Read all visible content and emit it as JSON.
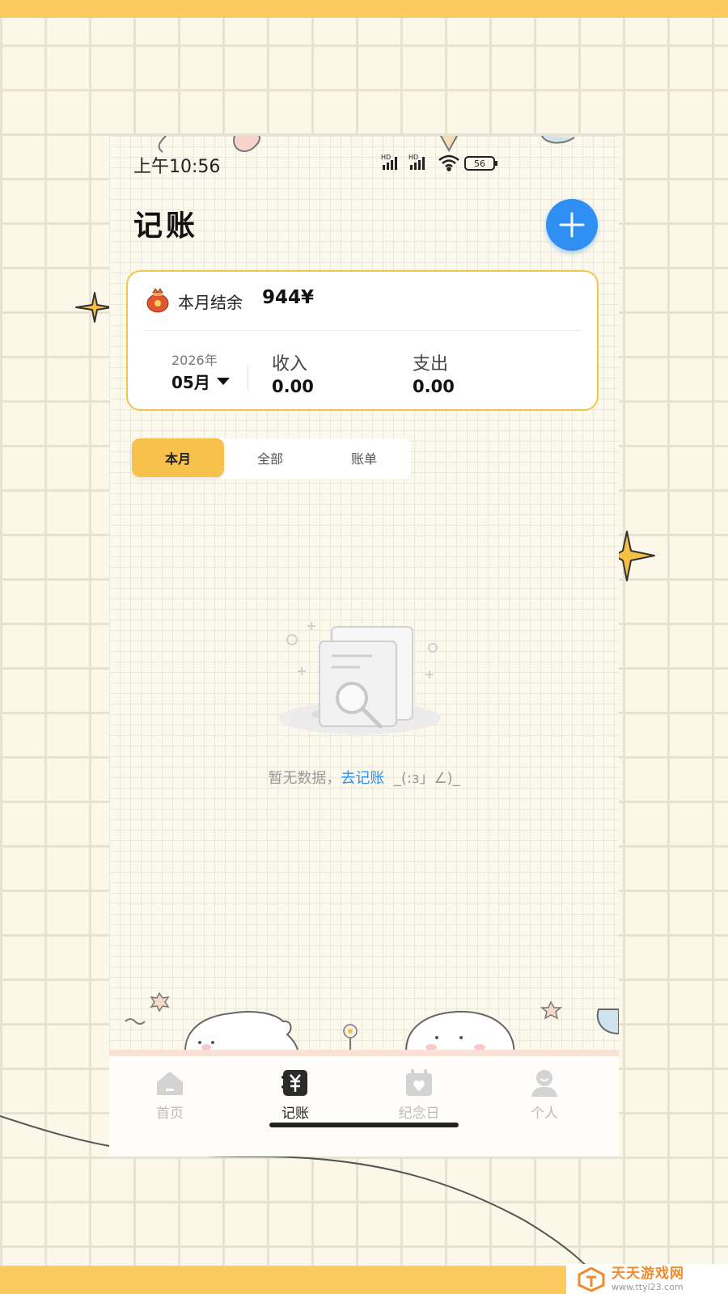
{
  "status_bar": {
    "time": "上午10:56",
    "battery": "56",
    "network_label": "HD"
  },
  "header": {
    "title": "记账",
    "add_icon": "plus-icon"
  },
  "summary": {
    "balance_label": "本月结余",
    "balance_value": "944¥",
    "year": "2026年",
    "month": "05月",
    "income_label": "收入",
    "income_value": "0.00",
    "expense_label": "支出",
    "expense_value": "0.00"
  },
  "tabs": [
    {
      "label": "本月",
      "active": true
    },
    {
      "label": "全部",
      "active": false
    },
    {
      "label": "账单",
      "active": false
    }
  ],
  "empty_state": {
    "text": "暂无数据，",
    "link": "去记账",
    "emoticon": "_(:з」∠)_"
  },
  "nav": [
    {
      "label": "首页",
      "icon": "home-icon",
      "active": false
    },
    {
      "label": "记账",
      "icon": "ledger-icon",
      "active": true
    },
    {
      "label": "纪念日",
      "icon": "calendar-heart-icon",
      "active": false
    },
    {
      "label": "个人",
      "icon": "person-icon",
      "active": false
    }
  ],
  "watermark": {
    "name": "天天游戏网",
    "url": "www.ttyl23.com"
  },
  "colors": {
    "accent_blue": "#2f8ff3",
    "accent_yellow": "#f7c24b",
    "stripe": "#fcca5f"
  }
}
